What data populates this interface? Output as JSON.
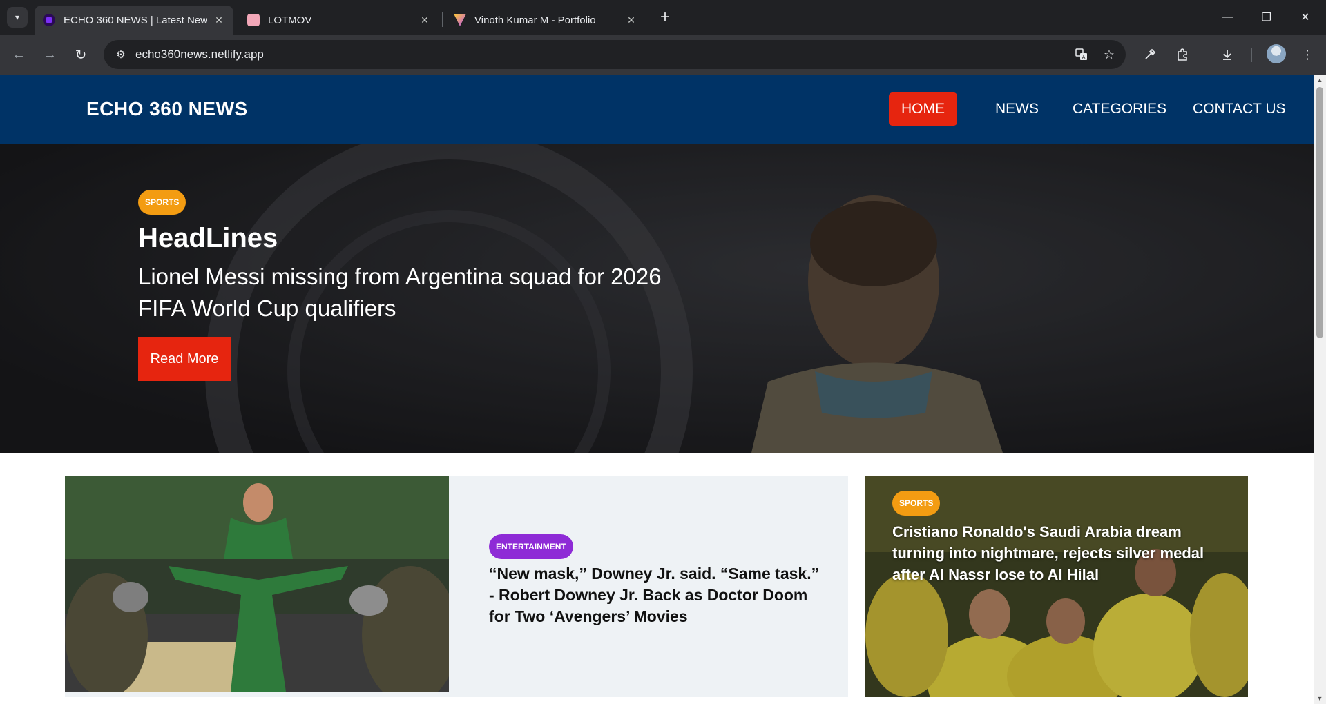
{
  "browser": {
    "tabs": [
      {
        "title": "ECHO 360 NEWS | Latest News",
        "active": true
      },
      {
        "title": "LOTMOV",
        "active": false
      },
      {
        "title": "Vinoth Kumar M - Portfolio",
        "active": false
      }
    ],
    "url": "echo360news.netlify.app",
    "icons": {
      "tab_search": "chevron-down-icon",
      "new_tab": "plus-icon",
      "back": "arrow-left-icon",
      "forward": "arrow-right-icon",
      "reload": "reload-icon",
      "site_info": "tune-icon",
      "translate": "translate-icon",
      "bookmark": "star-icon",
      "eyedropper": "eyedropper-icon",
      "extensions": "puzzle-icon",
      "downloads": "download-icon",
      "menu": "kebab-menu-icon"
    }
  },
  "site": {
    "logo": "ECHO 360 NEWS",
    "nav": [
      "HOME",
      "NEWS",
      "CATEGORIES",
      "CONTACT US"
    ],
    "active_nav": "HOME",
    "colors": {
      "header": "#003366",
      "accent": "#e6250f",
      "sports": "#f39c12",
      "entertainment": "#8e2bd6"
    }
  },
  "hero": {
    "category": "SPORTS",
    "title": "HeadLines",
    "headline": "Lionel Messi missing from Argentina squad for 2026 FIFA World Cup qualifiers",
    "cta": "Read More"
  },
  "cards": [
    {
      "category": "ENTERTAINMENT",
      "title": "“New mask,” Downey Jr. said. “Same task.” - Robert Downey Jr. Back as Doctor Doom for Two ‘Avengers’ Movies"
    },
    {
      "category": "SPORTS",
      "title": "Cristiano Ronaldo's Saudi Arabia dream turning into nightmare, rejects silver medal after Al Nassr lose to Al Hilal"
    }
  ]
}
